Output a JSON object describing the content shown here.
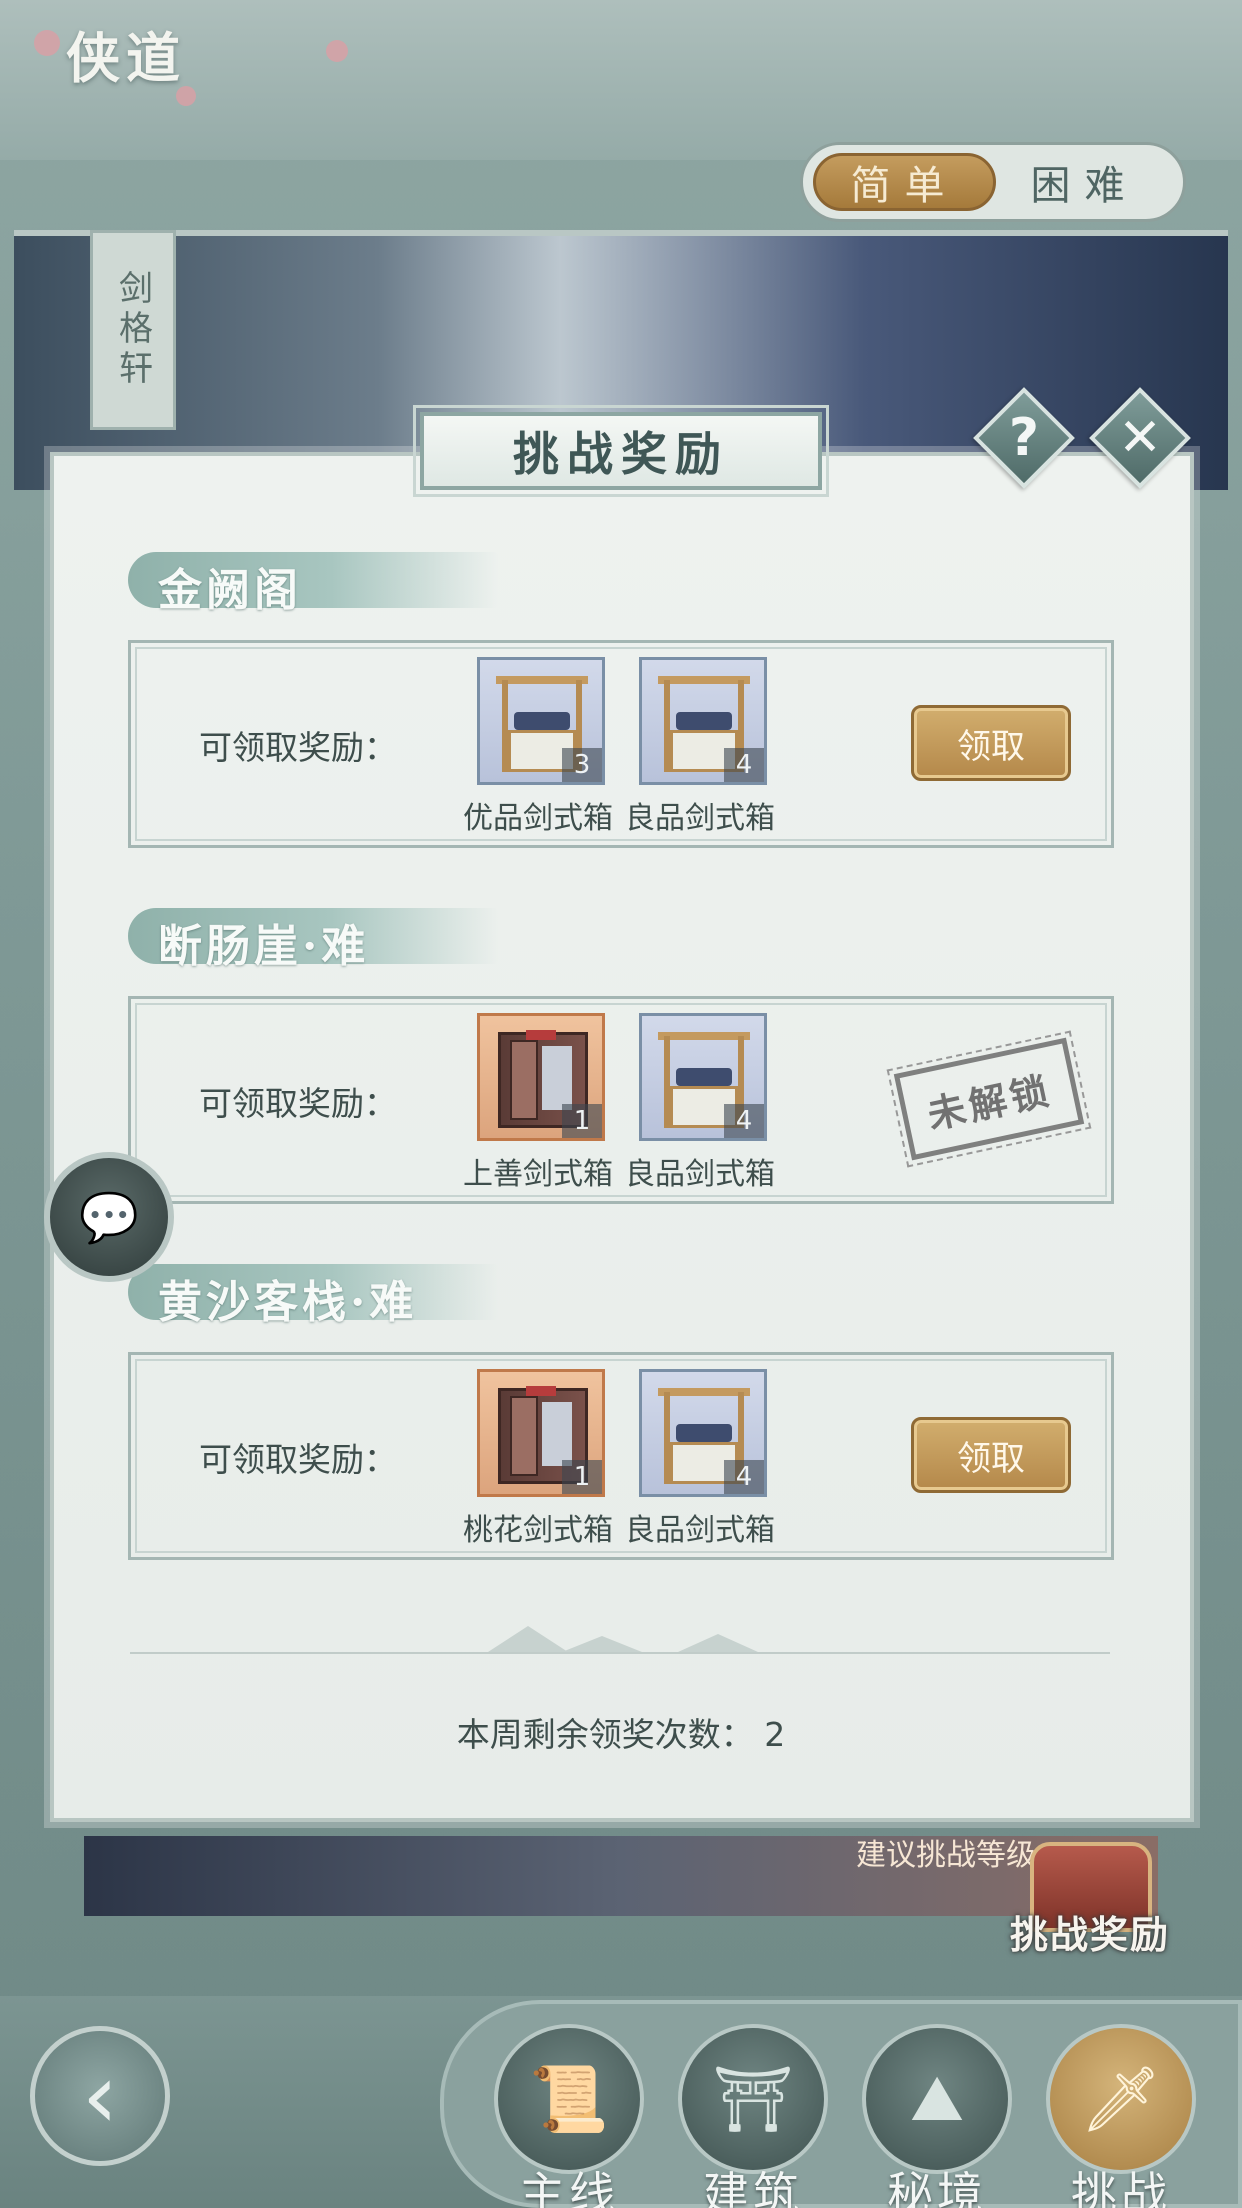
{
  "app": {
    "title": "侠道"
  },
  "difficulty": {
    "easy": "简单",
    "hard": "困难",
    "selected": "easy"
  },
  "location": {
    "name": "剑格轩"
  },
  "modal": {
    "title": "挑战奖励",
    "help_icon": "question-icon",
    "close_icon": "close-icon",
    "reward_label": "可领取奖励：",
    "sections": [
      {
        "name": "金阙阁",
        "items": [
          {
            "name": "优品剑式箱",
            "count": "3",
            "icon": "stall-icon"
          },
          {
            "name": "良品剑式箱",
            "count": "4",
            "icon": "stall-icon"
          }
        ],
        "action": "领取"
      },
      {
        "name": "断肠崖·难",
        "items": [
          {
            "name": "上善剑式箱",
            "count": "1",
            "icon": "cabinet-icon"
          },
          {
            "name": "良品剑式箱",
            "count": "4",
            "icon": "stall-icon"
          }
        ],
        "status": "未解锁"
      },
      {
        "name": "黄沙客栈·难",
        "items": [
          {
            "name": "桃花剑式箱",
            "count": "1",
            "icon": "cabinet-icon"
          },
          {
            "name": "良品剑式箱",
            "count": "4",
            "icon": "stall-icon"
          }
        ],
        "action": "领取"
      }
    ],
    "remaining_label": "本周剩余领奖次数：",
    "remaining_count": "2"
  },
  "bottom": {
    "suggest_text": "建议挑战等级",
    "challenge_reward_label": "挑战奖励",
    "nav": [
      {
        "label": "主线",
        "icon": "scroll-icon"
      },
      {
        "label": "建筑",
        "icon": "well-icon"
      },
      {
        "label": "秘境",
        "icon": "mountain-icon"
      },
      {
        "label": "挑战",
        "icon": "sword-icon",
        "active": true
      }
    ]
  },
  "colors": {
    "accent_gold": "#b4884a",
    "panel": "#e7ece9",
    "teal": "#8fb1aa"
  }
}
